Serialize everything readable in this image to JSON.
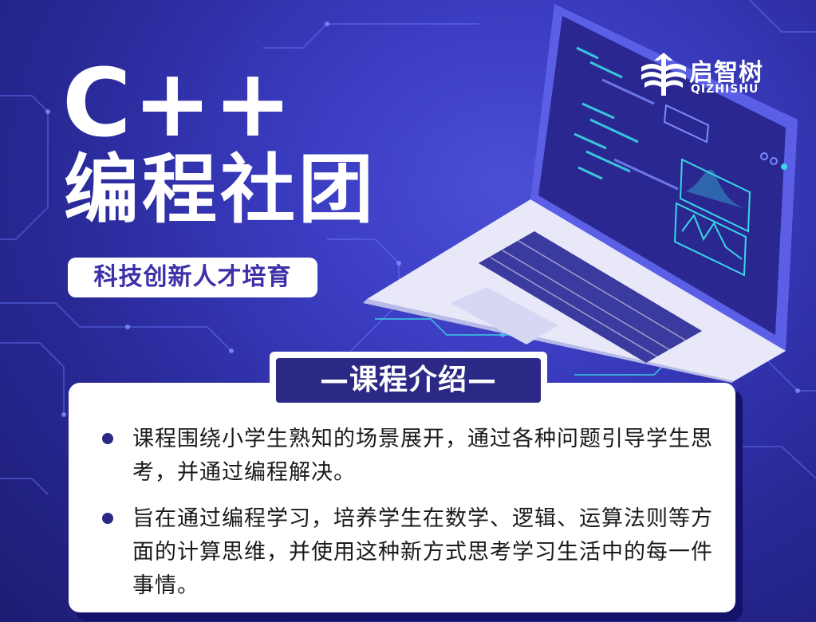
{
  "brand": {
    "name": "启智树",
    "subname": "QIZHISHU"
  },
  "hero": {
    "title_line1": "C++",
    "title_line2": "编程社团",
    "tagline": "科技创新人才培育"
  },
  "section": {
    "title": "—课程介绍—",
    "bullets": [
      "课程围绕小学生熟知的场景展开，通过各种问题引导学生思考，并通过编程解决。",
      "旨在通过编程学习，培养学生在数学、逻辑、运算法则等方面的计算思维，并使用这种新方式思考学习生活中的每一件事情。"
    ]
  },
  "colors": {
    "background": "#3a3cc0",
    "accent": "#2b2886",
    "tagline_text": "#3d2fa8",
    "circuit": "#6b7bff",
    "screen_glow": "#3ad6e6"
  },
  "icons": {
    "logo": "book-tree-logo-icon",
    "bullet": "bullet-dot-icon"
  }
}
